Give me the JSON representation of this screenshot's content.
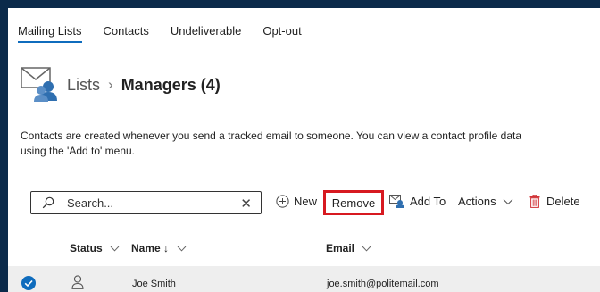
{
  "tabs": [
    {
      "label": "Mailing Lists",
      "active": true
    },
    {
      "label": "Contacts",
      "active": false
    },
    {
      "label": "Undeliverable",
      "active": false
    },
    {
      "label": "Opt-out",
      "active": false
    }
  ],
  "breadcrumb": {
    "lists_label": "Lists",
    "separator": "›",
    "current": "Managers (4)"
  },
  "description": {
    "line1": "Contacts are created whenever you send a tracked email to someone. You can view a contact profile data",
    "line2": "using the 'Add to' menu."
  },
  "toolbar": {
    "search_placeholder": "Search...",
    "new_label": "New",
    "remove_label": "Remove",
    "add_to_label": "Add To",
    "actions_label": "Actions",
    "delete_label": "Delete"
  },
  "table": {
    "columns": {
      "status": "Status",
      "name": "Name ↓",
      "email": "Email"
    },
    "rows": [
      {
        "name": "Joe Smith",
        "email": "joe.smith@politemail.com",
        "selected": true
      }
    ]
  },
  "colors": {
    "accent": "#0f6cbd",
    "highlight_border": "#d71920",
    "frame": "#0b2a4a"
  }
}
